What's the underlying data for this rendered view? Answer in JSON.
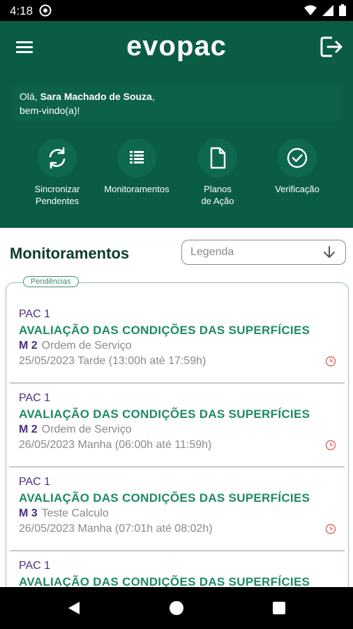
{
  "status_bar": {
    "time": "4:18"
  },
  "header": {
    "brand": "evopac",
    "welcome_prefix": "Olá, ",
    "user_name": "Sara Machado de Souza",
    "welcome_suffix": ",",
    "welcome_line2": "bem-vindo(a)!"
  },
  "actions": [
    {
      "label_line1": "Sincronizar",
      "label_line2": "Pendentes",
      "icon": "sync-icon"
    },
    {
      "label_line1": "Monitoramentos",
      "label_line2": "",
      "icon": "list-icon"
    },
    {
      "label_line1": "Planos",
      "label_line2": "de Ação",
      "icon": "document-icon"
    },
    {
      "label_line1": "Verificação",
      "label_line2": "",
      "icon": "check-circle-icon"
    }
  ],
  "main": {
    "title": "Monitoramentos",
    "legend_select": {
      "value": "Legenda"
    },
    "badge": "Pendências",
    "items": [
      {
        "pac": "PAC 1",
        "title": "AVALIAÇÃO DAS CONDIÇÕES DAS SUPERFÍCIES",
        "m_code": "M 2",
        "m_desc": "Ordem de Serviço",
        "date": "25/05/2023 Tarde (13:00h até 17:59h)"
      },
      {
        "pac": "PAC 1",
        "title": "AVALIAÇÃO DAS CONDIÇÕES DAS SUPERFÍCIES",
        "m_code": "M 2",
        "m_desc": "Ordem de Serviço",
        "date": "26/05/2023 Manha (06:00h até 11:59h)"
      },
      {
        "pac": "PAC 1",
        "title": "AVALIAÇÃO DAS CONDIÇÕES DAS SUPERFÍCIES",
        "m_code": "M 3",
        "m_desc": "Teste Calculo",
        "date": "26/05/2023 Manha (07:01h até 08:02h)"
      },
      {
        "pac": "PAC 1",
        "title": "AVALIAÇÃO DAS CONDIÇÕES DAS SUPERFÍCIES",
        "m_code": "",
        "m_desc": "",
        "date": ""
      }
    ]
  },
  "colors": {
    "header_green": "#0b5c45",
    "title_green": "#1e8a64",
    "pac_purple": "#4a2c83",
    "clock_red": "#e06666"
  }
}
